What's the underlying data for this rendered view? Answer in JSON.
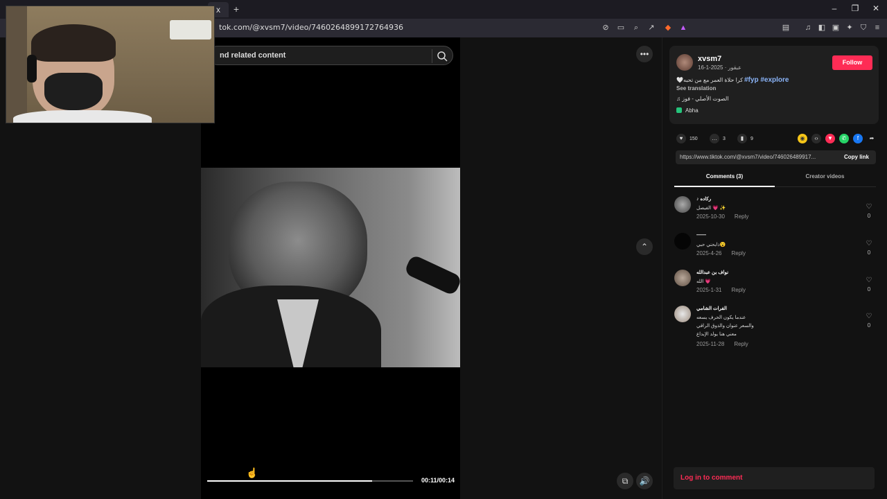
{
  "browser": {
    "tab_label": "x",
    "new_tab_label": "+",
    "url": "tok.com/@xvsm7/video/7460264899172764936",
    "window_controls": {
      "minimize": "–",
      "maximize": "❐",
      "close": "✕"
    }
  },
  "search": {
    "text": "nd related content",
    "icon": "search-icon"
  },
  "video": {
    "time_current": "00:11",
    "time_total": "00:14",
    "time_display": "00:11/00:14",
    "progress": 0.8
  },
  "author": {
    "username": "xvsm7",
    "nickname": "عبقور",
    "date": "2025-1-16",
    "sub_line": "عبقور · 2025-1-16",
    "follow_label": "Follow",
    "description": "🤍كرا حلاة العمر مع من تحبه",
    "hashtags": "#fyp #explore",
    "see_translation": "See translation",
    "music": "الصوت الأصلي - فوز",
    "location": "Abha"
  },
  "stats": {
    "likes": "150",
    "comments": "3",
    "saves": "9"
  },
  "share": {
    "url": "https://www.tiktok.com/@xvsm7/video/746026489917...",
    "copy_label": "Copy link"
  },
  "tabs": [
    {
      "label": "Comments (3)"
    },
    {
      "label": "Creator videos"
    }
  ],
  "comments": [
    {
      "name": "♪ ركاده",
      "text": "الفيصل 💗 ✨",
      "date": "2025-10-30",
      "reply": "Reply",
      "likes": "0"
    },
    {
      "name": "——",
      "text": "ذابحني حبي😮",
      "date": "2025-4-26",
      "reply": "Reply",
      "likes": "0"
    },
    {
      "name": "نواف بن عبدالله",
      "text": "الله 💗",
      "date": "2025-1-31",
      "reply": "Reply",
      "likes": "0"
    },
    {
      "name": "الفرات الشامي",
      "text": "عندما يكون الحرف يسعه\nوالسعر عنوان والذوق الراقي\nمعني هنا يولد الإبداع",
      "date": "2025-11-28",
      "reply": "Reply",
      "likes": "0"
    }
  ],
  "login": {
    "label": "Log in to comment"
  },
  "colors": {
    "accent": "#fe2c55",
    "hashtag": "#8ab4f8",
    "background": "#121212"
  }
}
